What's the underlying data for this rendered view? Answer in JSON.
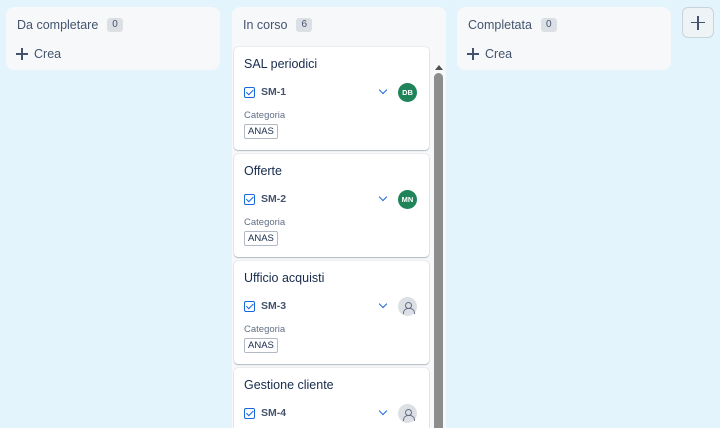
{
  "columns": [
    {
      "title": "Da completare",
      "count": "0",
      "create_label": "Crea"
    },
    {
      "title": "In corso",
      "count": "6"
    },
    {
      "title": "Completata",
      "count": "0",
      "create_label": "Crea"
    }
  ],
  "cards": [
    {
      "title": "SAL periodici",
      "key": "SM-1",
      "assignee": "DB",
      "field_label": "Categoria",
      "field_value": "ANAS"
    },
    {
      "title": "Offerte",
      "key": "SM-2",
      "assignee": "MN",
      "field_label": "Categoria",
      "field_value": "ANAS"
    },
    {
      "title": "Ufficio acquisti",
      "key": "SM-3",
      "assignee": "",
      "field_label": "Categoria",
      "field_value": "ANAS"
    },
    {
      "title": "Gestione cliente",
      "key": "SM-4",
      "assignee": ""
    }
  ],
  "icons": {
    "create": "plus-icon",
    "add_column": "plus-icon",
    "issue_type": "checkbox-icon",
    "priority": "chevron-down-icon",
    "unassigned": "person-icon"
  },
  "colors": {
    "background": "#e4f4fd",
    "column": "#f7f8f9",
    "avatar": "#1f845a",
    "accent": "#1868db"
  }
}
